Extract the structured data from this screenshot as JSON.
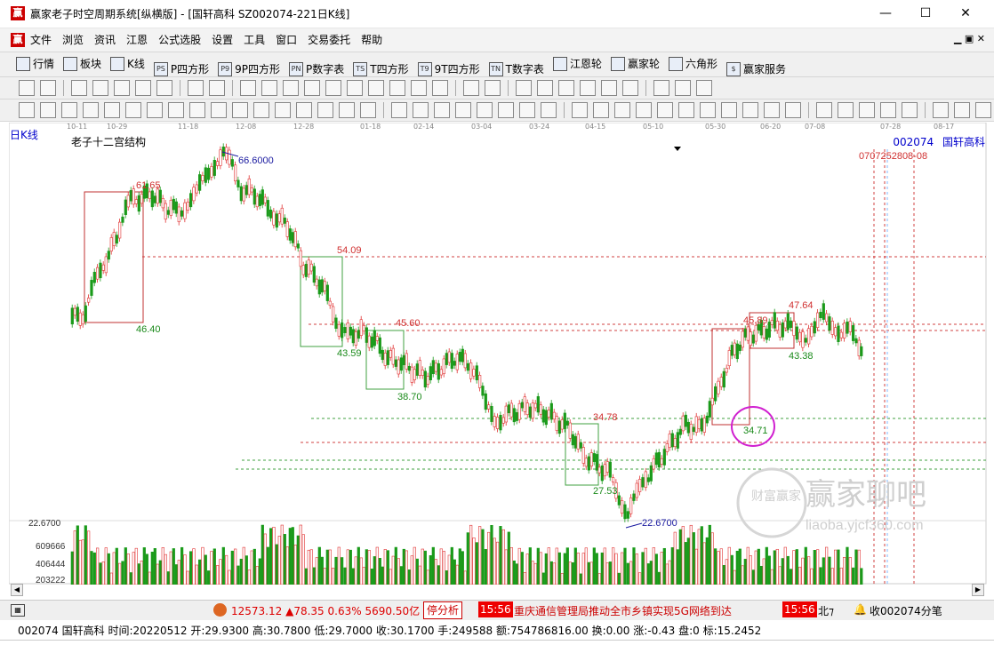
{
  "window": {
    "title": "赢家老子时空周期系统[纵横版] - [国轩高科  SZ002074-221日K线]",
    "logo_text": "赢",
    "controls": [
      "—",
      "☐",
      "✕"
    ]
  },
  "menu": [
    "文件",
    "浏览",
    "资讯",
    "江恩",
    "公式选股",
    "设置",
    "工具",
    "窗口",
    "交易委托",
    "帮助"
  ],
  "toolbar1": [
    {
      "icon": "table-icon",
      "label": "行情"
    },
    {
      "icon": "blocks-icon",
      "label": "板块"
    },
    {
      "icon": "kline-icon",
      "label": "K线"
    },
    {
      "icon": "ps-icon",
      "glyph": "PS",
      "label": "P四方形"
    },
    {
      "icon": "p9-icon",
      "glyph": "P9",
      "label": "9P四方形"
    },
    {
      "icon": "pn-icon",
      "glyph": "PN",
      "label": "P数字表"
    },
    {
      "icon": "ts-icon",
      "glyph": "TS",
      "label": "T四方形"
    },
    {
      "icon": "t9-icon",
      "glyph": "T9",
      "label": "9T四方形"
    },
    {
      "icon": "tn-icon",
      "glyph": "TN",
      "label": "T数字表"
    },
    {
      "icon": "target-icon",
      "label": "江恩轮"
    },
    {
      "icon": "wheel-icon",
      "label": "赢家轮"
    },
    {
      "icon": "hexagon-icon",
      "label": "六角形"
    },
    {
      "icon": "dollar-icon",
      "glyph": "$",
      "label": "赢家服务"
    }
  ],
  "chart": {
    "period_label": "日K线",
    "indicator_name": "老子十二宫结构",
    "stock_code": "002074",
    "stock_name": "国轩高科",
    "dates": [
      "10-11",
      "10-29",
      "11-18",
      "12-08",
      "12-28",
      "01-18",
      "02-14",
      "03-04",
      "03-24",
      "04-15",
      "05-10",
      "05-30",
      "06-20",
      "07-08",
      "07-28",
      "08-17"
    ],
    "price_labels": {
      "high": "66.6000",
      "low": "22.6700",
      "p1": "61.65",
      "p2": "46.40",
      "p3": "54.09",
      "p4": "43.59",
      "p5": "45.60",
      "p6": "38.70",
      "p7": "34.78",
      "p8": "27.53",
      "p9": "45.89",
      "p10": "47.64",
      "p11": "43.38",
      "p12": "34.71",
      "date_marks": "0707252808-08"
    },
    "volume_labels": {
      "max": "22.6700",
      "v1": "609666",
      "v2": "406444",
      "v3": "203222"
    },
    "watermark": {
      "title": "赢家聊吧",
      "url": "liaoba.yjcf360.com",
      "seal": "财富赢家"
    }
  },
  "index_bar": {
    "index": "12573.12",
    "change": "▲78.35",
    "pct": "0.63%",
    "amount": "5690.50亿",
    "btn": "停分析",
    "time1": "15:56",
    "news": "重庆通信管理局推动全市乡镇实现5G网络到达",
    "time2": "15:56",
    "north": "北⁊",
    "collect": "收002074分笔"
  },
  "info_bar": "002074 国轩高科 时间:20220512 开:29.9300 高:30.7800 低:29.7000 收:30.1700 手:249588 额:754786816.00 换:0.00 涨:-0.43 盘:0 标:15.2452"
}
